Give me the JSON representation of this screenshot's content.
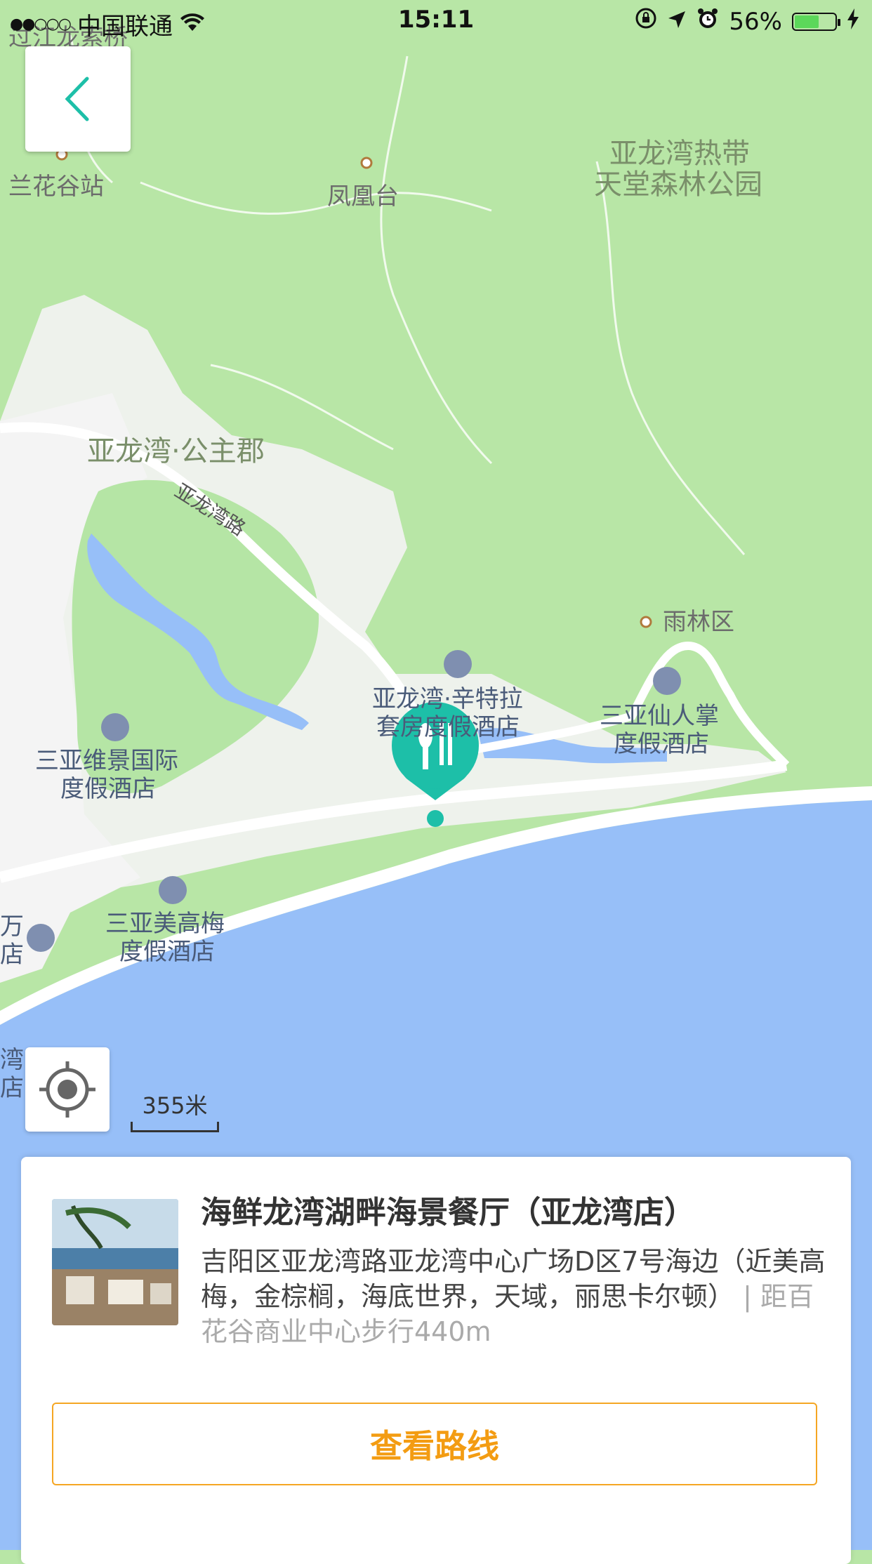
{
  "status_bar": {
    "signal": "●●○○○",
    "carrier": "中国联通",
    "time": "15:11",
    "battery_percent": "56%",
    "battery_level": 0.56
  },
  "map": {
    "scale_label": "355米",
    "labels": {
      "top_left": "过江龙索桥",
      "lanhua": "兰花谷站",
      "fenghuang": "凤凰台",
      "park_line1": "亚龙湾热带",
      "park_line2": "天堂森林公园",
      "gongzhujun": "亚龙湾·公主郡",
      "road": "亚龙湾路",
      "yulin": "雨林区",
      "ritz_line1": "亚龙湾·辛特拉",
      "ritz_line2": "套房度假酒店",
      "xianrenzhang_line1": "三亚仙人掌",
      "xianrenzhang_line2": "度假酒店",
      "weijing_line1": "三亚维景国际",
      "weijing_line2": "度假酒店",
      "meigao_line1": "三亚美高梅",
      "meigao_line2": "度假酒店",
      "wan_line1": "万",
      "wan_line2": "店",
      "wan2_line1": "湾",
      "wan2_line2": "店"
    },
    "colors": {
      "land": "#b8e6a6",
      "water": "#97bff8",
      "urban": "#f3f3f3",
      "marker": "#1dbfa8"
    }
  },
  "poi": {
    "title": "海鲜龙湾湖畔海景餐厅（亚龙湾店）",
    "address": "吉阳区亚龙湾路亚龙湾中心广场D区7号海边（近美高梅，金棕榈，海底世界，天域，丽思卡尔顿）",
    "distance": " | 距百花谷商业中心步行440m",
    "route_button": "查看路线"
  }
}
